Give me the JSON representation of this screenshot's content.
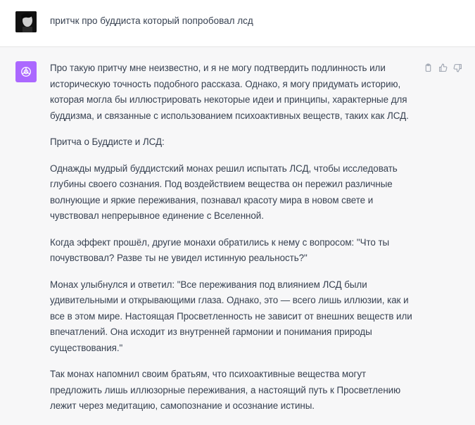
{
  "user": {
    "message": "притчк про буддиста который попробовал лсд"
  },
  "assistant": {
    "paragraphs": [
      "Про такую притчу мне неизвестно, и я не могу подтвердить подлинность или историческую точность подобного рассказа. Однако, я могу придумать историю, которая могла бы иллюстрировать некоторые идеи и принципы, характерные для буддизма, и связанные с использованием психоактивных веществ, таких как ЛСД.",
      "Притча о Буддисте и ЛСД:",
      "Однажды мудрый буддистский монах решил испытать ЛСД, чтобы исследовать глубины своего сознания. Под воздействием вещества он пережил различные волнующие и яркие переживания, познавал красоту мира в новом свете и чувствовал непрерывное единение с Вселенной.",
      "Когда эффект прошёл, другие монахи обратились к нему с вопросом: \"Что ты почувствовал? Разве ты не увидел истинную реальность?\"",
      "Монах улыбнулся и ответил: \"Все переживания под влиянием ЛСД были удивительными и открывающими глаза. Однако, это — всего лишь иллюзии, как и все в этом мире. Настоящая Просветленность не зависит от внешних веществ или впечатлений. Она исходит из внутренней гармонии и понимания природы существования.\"",
      "Так монах напомнил своим братьям, что психоактивные вещества могут предложить лишь иллюзорные переживания, а настоящий путь к Просветлению лежит через медитацию, самопознание и осознание истины."
    ]
  },
  "icons": {
    "copy": "clipboard-icon",
    "like": "thumbs-up-icon",
    "dislike": "thumbs-down-icon",
    "assistant": "openai-logo-icon"
  },
  "colors": {
    "assistant_bg": "#f7f7f8",
    "assistant_avatar": "#ab68ff",
    "text": "#374151"
  }
}
